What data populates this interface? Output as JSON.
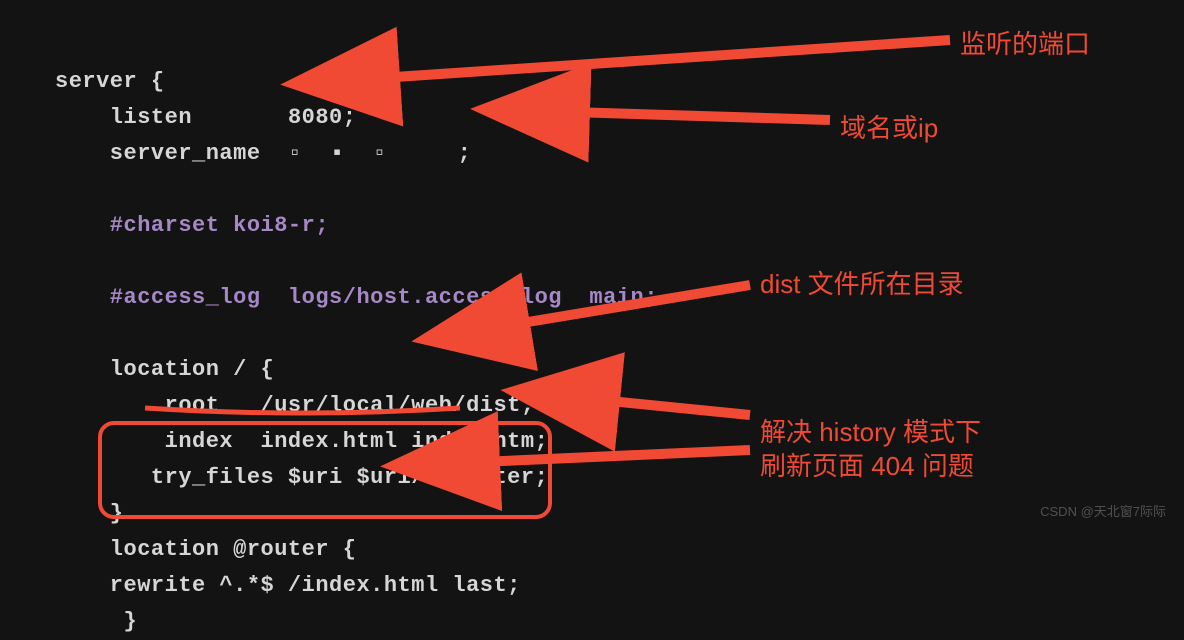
{
  "code": {
    "l1": "server {",
    "l2_a": "    listen       ",
    "l2_b": "8080",
    "l2_c": ";",
    "l3_a": "    server_name  ",
    "l3_b": ";",
    "l4": "",
    "l5": "    #charset koi8-r;",
    "l6": "",
    "l7": "    #access_log  logs/host.access.log  main;",
    "l8": "",
    "l9": "    location / {",
    "l10": "        root   /usr/local/web/dist;",
    "l11": "        index  index.html index.htm;",
    "l12": "       try_files $uri $uri/ @router;",
    "l13": "    }",
    "l14": "    location @router {",
    "l15": "    rewrite ^.*$ /index.html last;",
    "l16": "     }"
  },
  "annotations": {
    "a1": "监听的端口",
    "a2": "域名或ip",
    "a3": "dist 文件所在目录",
    "a4_l1": "解决 history 模式下",
    "a4_l2": "刷新页面 404 问题"
  },
  "watermark": "CSDN @天北窗7际际"
}
